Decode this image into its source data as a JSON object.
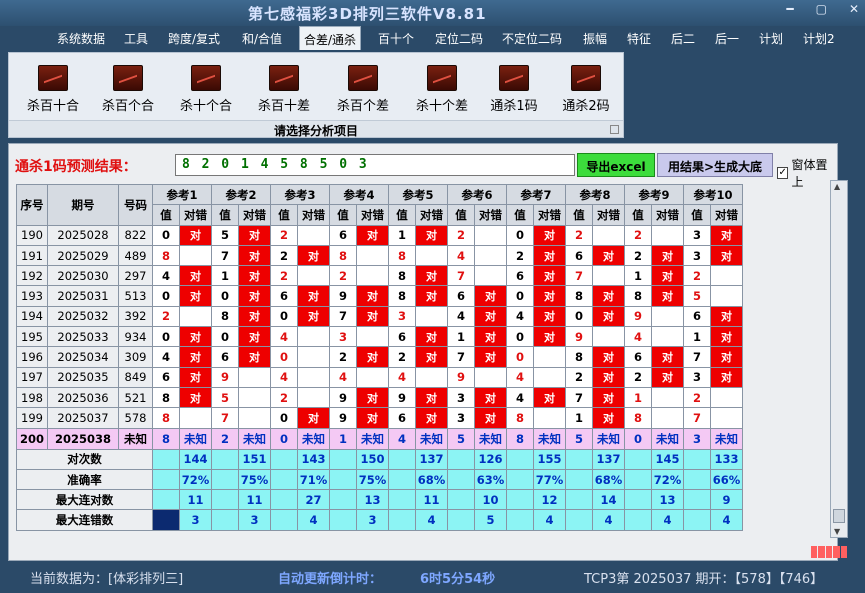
{
  "window": {
    "title": "第七感福彩3D排列三软件V8.81",
    "minimize_glyph": "━",
    "restore_glyph": "▢",
    "close_glyph": "✕"
  },
  "menu": [
    "系统数据",
    "工具",
    "跨度/复式",
    "和/合值",
    "合差/通杀",
    "百十个",
    "定位二码",
    "不定位二码",
    "振幅",
    "特征",
    "后二",
    "后一",
    "计划",
    "计划2"
  ],
  "menu_active_index": 4,
  "ribbon": {
    "buttons": [
      "杀百十合",
      "杀百个合",
      "杀十个合",
      "杀百十差",
      "杀百个差",
      "杀十个差",
      "通杀1码",
      "通杀2码"
    ],
    "caption": "请选择分析项目",
    "icon": "chart-icon"
  },
  "prediction": {
    "label": "通杀1码预测结果：",
    "value": "8 2 0 1 4 5 8 5 0 3",
    "excel_button": "导出excel",
    "generate_button": "用结果>生成大底",
    "topmost_label": "窗体置上",
    "topmost_checked": "✓"
  },
  "table": {
    "headers": {
      "seq": "序号",
      "period": "期号",
      "code": "号码"
    },
    "ref_labels": [
      "参考1",
      "参考2",
      "参考3",
      "参考4",
      "参考5",
      "参考6",
      "参考7",
      "参考8",
      "参考9",
      "参考10"
    ],
    "sub_value": "值",
    "sub_result": "对错",
    "hit_text": "对",
    "rows": [
      {
        "seq": "190",
        "period": "2025028",
        "code": "822",
        "refs": [
          [
            "0",
            1
          ],
          [
            "5",
            1
          ],
          [
            "2",
            0
          ],
          [
            "6",
            1
          ],
          [
            "1",
            1
          ],
          [
            "2",
            0
          ],
          [
            "0",
            1
          ],
          [
            "2",
            0
          ],
          [
            "2",
            0
          ],
          [
            "3",
            1
          ]
        ]
      },
      {
        "seq": "191",
        "period": "2025029",
        "code": "489",
        "refs": [
          [
            "8",
            0
          ],
          [
            "7",
            1
          ],
          [
            "2",
            1
          ],
          [
            "8",
            0
          ],
          [
            "8",
            0
          ],
          [
            "4",
            0
          ],
          [
            "2",
            1
          ],
          [
            "6",
            1
          ],
          [
            "2",
            1
          ],
          [
            "3",
            1
          ]
        ]
      },
      {
        "seq": "192",
        "period": "2025030",
        "code": "297",
        "refs": [
          [
            "4",
            1
          ],
          [
            "1",
            1
          ],
          [
            "2",
            0
          ],
          [
            "2",
            0
          ],
          [
            "8",
            1
          ],
          [
            "7",
            0
          ],
          [
            "6",
            1
          ],
          [
            "7",
            0
          ],
          [
            "1",
            1
          ],
          [
            "2",
            0
          ]
        ]
      },
      {
        "seq": "193",
        "period": "2025031",
        "code": "513",
        "refs": [
          [
            "0",
            1
          ],
          [
            "0",
            1
          ],
          [
            "6",
            1
          ],
          [
            "9",
            1
          ],
          [
            "8",
            1
          ],
          [
            "6",
            1
          ],
          [
            "0",
            1
          ],
          [
            "8",
            1
          ],
          [
            "8",
            1
          ],
          [
            "5",
            0
          ]
        ]
      },
      {
        "seq": "194",
        "period": "2025032",
        "code": "392",
        "refs": [
          [
            "2",
            0
          ],
          [
            "8",
            1
          ],
          [
            "0",
            1
          ],
          [
            "7",
            1
          ],
          [
            "3",
            0
          ],
          [
            "4",
            1
          ],
          [
            "4",
            1
          ],
          [
            "0",
            1
          ],
          [
            "9",
            0
          ],
          [
            "6",
            1
          ]
        ]
      },
      {
        "seq": "195",
        "period": "2025033",
        "code": "934",
        "refs": [
          [
            "0",
            1
          ],
          [
            "0",
            1
          ],
          [
            "4",
            0
          ],
          [
            "3",
            0
          ],
          [
            "6",
            1
          ],
          [
            "1",
            1
          ],
          [
            "0",
            1
          ],
          [
            "9",
            0
          ],
          [
            "4",
            0
          ],
          [
            "1",
            1
          ]
        ]
      },
      {
        "seq": "196",
        "period": "2025034",
        "code": "309",
        "refs": [
          [
            "4",
            1
          ],
          [
            "6",
            1
          ],
          [
            "0",
            0
          ],
          [
            "2",
            1
          ],
          [
            "2",
            1
          ],
          [
            "7",
            1
          ],
          [
            "0",
            0
          ],
          [
            "8",
            1
          ],
          [
            "6",
            1
          ],
          [
            "7",
            1
          ]
        ]
      },
      {
        "seq": "197",
        "period": "2025035",
        "code": "849",
        "refs": [
          [
            "6",
            1
          ],
          [
            "9",
            0
          ],
          [
            "4",
            0
          ],
          [
            "4",
            0
          ],
          [
            "4",
            0
          ],
          [
            "9",
            0
          ],
          [
            "4",
            0
          ],
          [
            "2",
            1
          ],
          [
            "2",
            1
          ],
          [
            "3",
            1
          ]
        ]
      },
      {
        "seq": "198",
        "period": "2025036",
        "code": "521",
        "refs": [
          [
            "8",
            1
          ],
          [
            "5",
            0
          ],
          [
            "2",
            0
          ],
          [
            "9",
            1
          ],
          [
            "9",
            1
          ],
          [
            "3",
            1
          ],
          [
            "4",
            1
          ],
          [
            "7",
            1
          ],
          [
            "1",
            0
          ],
          [
            "2",
            0
          ]
        ]
      },
      {
        "seq": "199",
        "period": "2025037",
        "code": "578",
        "refs": [
          [
            "8",
            0
          ],
          [
            "7",
            0
          ],
          [
            "0",
            1
          ],
          [
            "9",
            1
          ],
          [
            "6",
            1
          ],
          [
            "3",
            1
          ],
          [
            "8",
            0
          ],
          [
            "1",
            1
          ],
          [
            "8",
            0
          ],
          [
            "7",
            0
          ]
        ]
      }
    ],
    "unknown_row": {
      "seq": "200",
      "period": "2025038",
      "code": "未知",
      "values": [
        "8",
        "2",
        "0",
        "1",
        "4",
        "5",
        "8",
        "5",
        "0",
        "3"
      ],
      "result": "未知"
    },
    "stats": [
      {
        "label": "对次数",
        "values": [
          "144",
          "151",
          "143",
          "150",
          "137",
          "126",
          "155",
          "137",
          "145",
          "133"
        ]
      },
      {
        "label": "准确率",
        "values": [
          "72%",
          "75%",
          "71%",
          "75%",
          "68%",
          "63%",
          "77%",
          "68%",
          "72%",
          "66%"
        ]
      },
      {
        "label": "最大连对数",
        "values": [
          "11",
          "11",
          "27",
          "13",
          "11",
          "10",
          "12",
          "14",
          "13",
          "9"
        ]
      },
      {
        "label": "最大连错数",
        "values": [
          "3",
          "3",
          "4",
          "3",
          "4",
          "5",
          "4",
          "4",
          "4",
          "4"
        ]
      }
    ]
  },
  "scroll": {
    "up": "▲",
    "down": "▼"
  },
  "status": {
    "current_label": "当前数据为：[体彩排列三]",
    "countdown_label": "自动更新倒计时：",
    "countdown_value": "6时5分54秒",
    "draw_info": "TCP3第 2025037 期开：【578】【746】"
  },
  "colors": {
    "hit": "#ee0000",
    "unknown_row": "#f4c9f4",
    "stat_row": "#8cf4f4",
    "excel": "#3cdc3c",
    "generate": "#c9c9ec"
  }
}
